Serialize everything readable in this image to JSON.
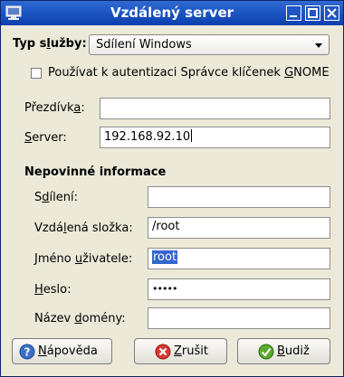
{
  "window": {
    "title": "Vzdálený server"
  },
  "service": {
    "label_pre": "Typ s",
    "label_u": "l",
    "label_post": "užby:",
    "selected": "Sdílení Windows"
  },
  "keyring": {
    "pre": "Používat k autentizaci Správce klíčenek ",
    "u": "G",
    "post": "NOME",
    "checked": false
  },
  "nickname": {
    "pre": "Přezdívk",
    "u": "a",
    "post": ":",
    "value": ""
  },
  "server": {
    "pre": "",
    "u": "S",
    "post": "erver:",
    "value": "192.168.92.10"
  },
  "optional": {
    "heading": "Nepovinné informace",
    "share": {
      "pre": "S",
      "u": "d",
      "post": "ílení:",
      "value": ""
    },
    "folder": {
      "pre": "Vzdá",
      "u": "l",
      "post": "ená složka:",
      "value": "/root"
    },
    "user": {
      "pre": "Jméno ",
      "u": "u",
      "post": "živatele:",
      "value": "root"
    },
    "password": {
      "pre": "",
      "u": "H",
      "post": "eslo:",
      "value": "•••••"
    },
    "domain": {
      "pre": "Název ",
      "u": "d",
      "post": "omény:",
      "value": ""
    }
  },
  "buttons": {
    "help": {
      "pre": "",
      "u": "N",
      "post": "ápověda"
    },
    "cancel": {
      "pre": "",
      "u": "Z",
      "post": "rušit"
    },
    "ok": {
      "pre": "",
      "u": "B",
      "post": "udiž"
    }
  },
  "icons": {
    "app": "server-icon",
    "help": "help-icon",
    "cancel": "cancel-icon",
    "ok": "ok-icon"
  },
  "colors": {
    "titlebar": "#1e56c4",
    "selection": "#3465d0",
    "dialog_bg": "#ece9d8"
  }
}
